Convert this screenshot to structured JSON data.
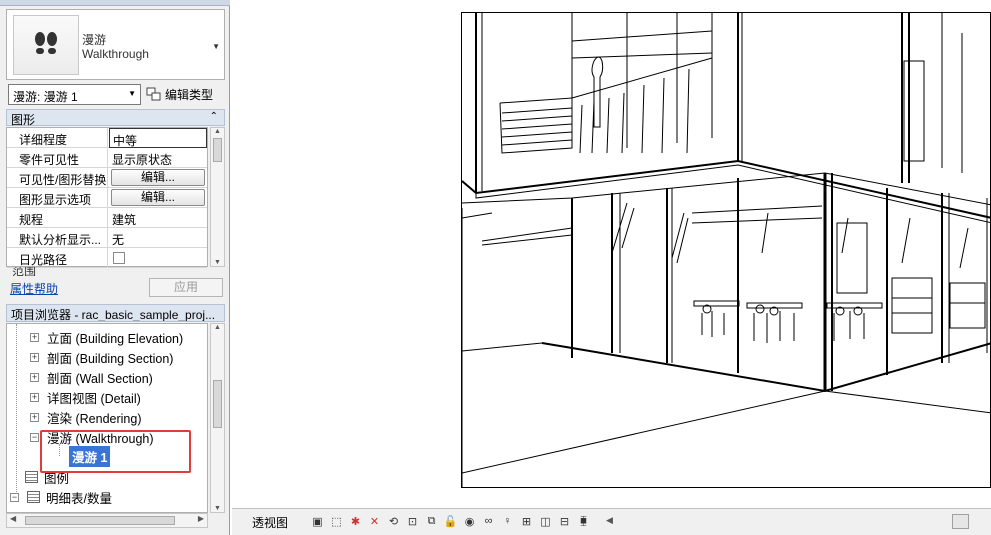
{
  "properties": {
    "type_name_cn": "漫游",
    "type_name_en": "Walkthrough",
    "instance_selector": "漫游: 漫游 1",
    "edit_type_label": "编辑类型",
    "section_graphics": "图形",
    "rows": [
      {
        "name": "详细程度",
        "value": "中等"
      },
      {
        "name": "零件可见性",
        "value": "显示原状态"
      },
      {
        "name": "可见性/图形替换",
        "button": "编辑..."
      },
      {
        "name": "图形显示选项",
        "button": "编辑..."
      },
      {
        "name": "规程",
        "value": "建筑"
      },
      {
        "name": "默认分析显示...",
        "value": "无"
      },
      {
        "name": "日光路径",
        "value": ""
      }
    ],
    "partial_section": "范围",
    "help_link": "属性帮助",
    "apply_button": "应用"
  },
  "browser": {
    "title": "项目浏览器 - rac_basic_sample_proj...",
    "items": [
      {
        "label": "立面 (Building Elevation)"
      },
      {
        "label": "剖面 (Building Section)"
      },
      {
        "label": "剖面 (Wall Section)"
      },
      {
        "label": "详图视图 (Detail)"
      },
      {
        "label": "渲染 (Rendering)"
      },
      {
        "label": "漫游 (Walkthrough)"
      }
    ],
    "selected_child": "漫游 1",
    "legend": "图例",
    "schedules": "明细表/数量"
  },
  "viewbar": {
    "label": "透视图"
  },
  "colors": {
    "accent_selection": "#3875d7",
    "highlight_box": "#e43a3a",
    "panel_header": "#dde6f0"
  }
}
